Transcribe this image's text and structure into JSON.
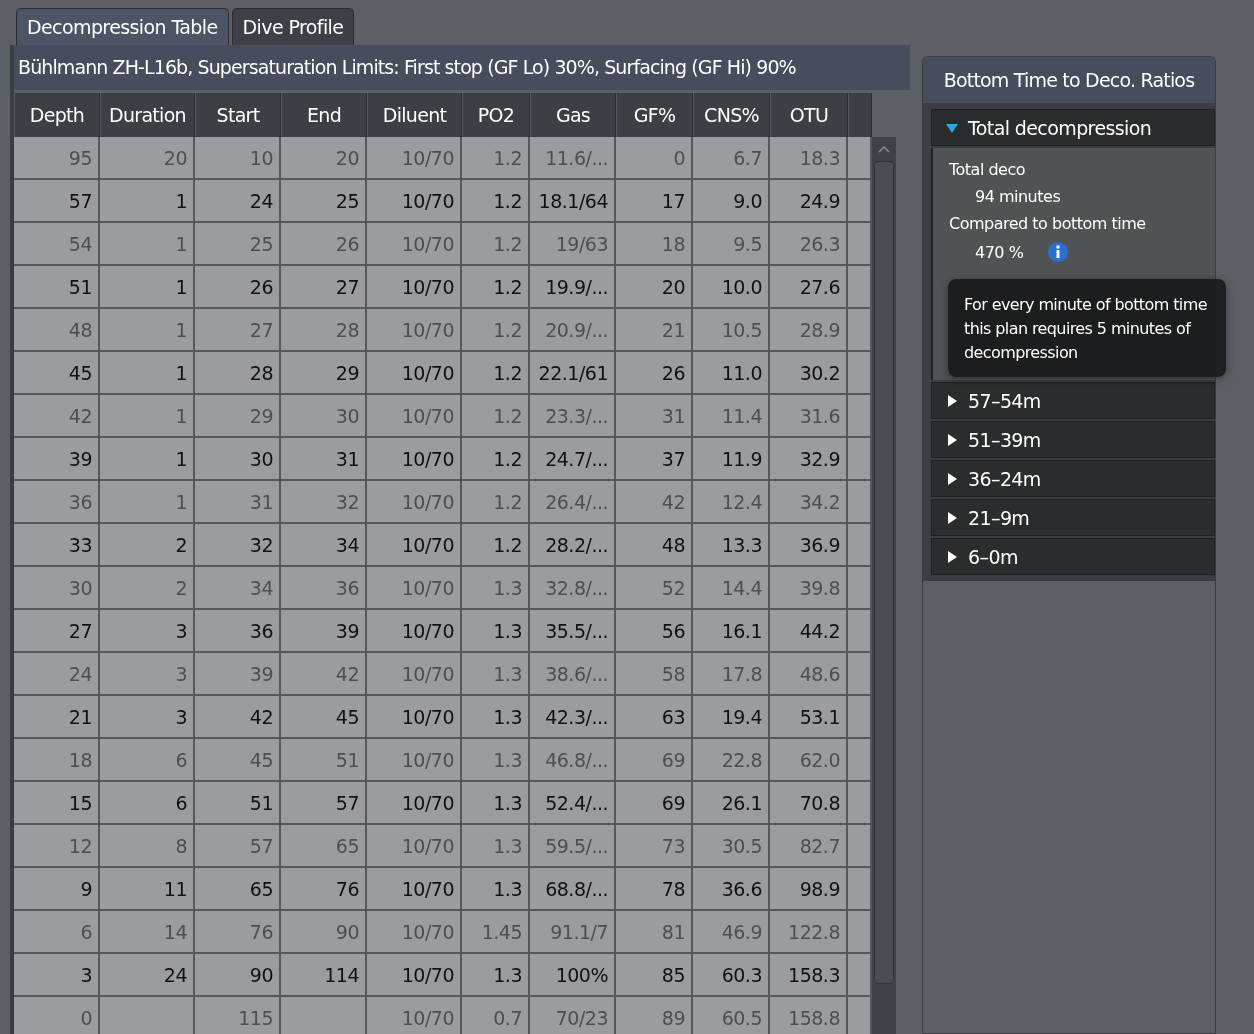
{
  "tabs": [
    {
      "label": "Decompression Table",
      "selected": true
    },
    {
      "label": "Dive Profile",
      "selected": false
    }
  ],
  "table": {
    "caption": "Bühlmann ZH-L16b, Supersaturation Limits: First stop (GF Lo) 30%, Surfacing (GF Hi) 90%",
    "columns": [
      "Depth",
      "Duration",
      "Start",
      "End",
      "Diluent",
      "PO2",
      "Gas",
      "GF%",
      "CNS%",
      "OTU"
    ],
    "rows": [
      {
        "dimmed": true,
        "cells": [
          "95",
          "20",
          "10",
          "20",
          "10/70",
          "1.2",
          "11.6/...",
          "0",
          "6.7",
          "18.3"
        ]
      },
      {
        "dimmed": false,
        "cells": [
          "57",
          "1",
          "24",
          "25",
          "10/70",
          "1.2",
          "18.1/64",
          "17",
          "9.0",
          "24.9"
        ]
      },
      {
        "dimmed": true,
        "cells": [
          "54",
          "1",
          "25",
          "26",
          "10/70",
          "1.2",
          "19/63",
          "18",
          "9.5",
          "26.3"
        ]
      },
      {
        "dimmed": false,
        "cells": [
          "51",
          "1",
          "26",
          "27",
          "10/70",
          "1.2",
          "19.9/...",
          "20",
          "10.0",
          "27.6"
        ]
      },
      {
        "dimmed": true,
        "cells": [
          "48",
          "1",
          "27",
          "28",
          "10/70",
          "1.2",
          "20.9/...",
          "21",
          "10.5",
          "28.9"
        ]
      },
      {
        "dimmed": false,
        "cells": [
          "45",
          "1",
          "28",
          "29",
          "10/70",
          "1.2",
          "22.1/61",
          "26",
          "11.0",
          "30.2"
        ]
      },
      {
        "dimmed": true,
        "cells": [
          "42",
          "1",
          "29",
          "30",
          "10/70",
          "1.2",
          "23.3/...",
          "31",
          "11.4",
          "31.6"
        ]
      },
      {
        "dimmed": false,
        "cells": [
          "39",
          "1",
          "30",
          "31",
          "10/70",
          "1.2",
          "24.7/...",
          "37",
          "11.9",
          "32.9"
        ]
      },
      {
        "dimmed": true,
        "cells": [
          "36",
          "1",
          "31",
          "32",
          "10/70",
          "1.2",
          "26.4/...",
          "42",
          "12.4",
          "34.2"
        ]
      },
      {
        "dimmed": false,
        "cells": [
          "33",
          "2",
          "32",
          "34",
          "10/70",
          "1.2",
          "28.2/...",
          "48",
          "13.3",
          "36.9"
        ]
      },
      {
        "dimmed": true,
        "cells": [
          "30",
          "2",
          "34",
          "36",
          "10/70",
          "1.3",
          "32.8/...",
          "52",
          "14.4",
          "39.8"
        ]
      },
      {
        "dimmed": false,
        "cells": [
          "27",
          "3",
          "36",
          "39",
          "10/70",
          "1.3",
          "35.5/...",
          "56",
          "16.1",
          "44.2"
        ]
      },
      {
        "dimmed": true,
        "cells": [
          "24",
          "3",
          "39",
          "42",
          "10/70",
          "1.3",
          "38.6/...",
          "58",
          "17.8",
          "48.6"
        ]
      },
      {
        "dimmed": false,
        "cells": [
          "21",
          "3",
          "42",
          "45",
          "10/70",
          "1.3",
          "42.3/...",
          "63",
          "19.4",
          "53.1"
        ]
      },
      {
        "dimmed": true,
        "cells": [
          "18",
          "6",
          "45",
          "51",
          "10/70",
          "1.3",
          "46.8/...",
          "69",
          "22.8",
          "62.0"
        ]
      },
      {
        "dimmed": false,
        "cells": [
          "15",
          "6",
          "51",
          "57",
          "10/70",
          "1.3",
          "52.4/...",
          "69",
          "26.1",
          "70.8"
        ]
      },
      {
        "dimmed": true,
        "cells": [
          "12",
          "8",
          "57",
          "65",
          "10/70",
          "1.3",
          "59.5/...",
          "73",
          "30.5",
          "82.7"
        ]
      },
      {
        "dimmed": false,
        "cells": [
          "9",
          "11",
          "65",
          "76",
          "10/70",
          "1.3",
          "68.8/...",
          "78",
          "36.6",
          "98.9"
        ]
      },
      {
        "dimmed": true,
        "cells": [
          "6",
          "14",
          "76",
          "90",
          "10/70",
          "1.45",
          "91.1/7",
          "81",
          "46.9",
          "122.8"
        ]
      },
      {
        "dimmed": false,
        "cells": [
          "3",
          "24",
          "90",
          "114",
          "10/70",
          "1.3",
          "100%",
          "85",
          "60.3",
          "158.3"
        ]
      },
      {
        "dimmed": true,
        "cells": [
          "0",
          null,
          "115",
          null,
          "10/70",
          "0.7",
          "70/23",
          "89",
          "60.5",
          "158.8"
        ]
      }
    ]
  },
  "ratios": {
    "title": "Bottom Time to Deco. Ratios",
    "sections": [
      {
        "label": "Total decompression",
        "expanded": true,
        "details": [
          {
            "label": "Total deco",
            "value": "94 minutes"
          },
          {
            "label": "Compared to bottom time",
            "value": "470 %",
            "info": true
          }
        ]
      },
      {
        "label": "57–54m",
        "expanded": false
      },
      {
        "label": "51–39m",
        "expanded": false
      },
      {
        "label": "36–24m",
        "expanded": false
      },
      {
        "label": "21–9m",
        "expanded": false
      },
      {
        "label": "6–0m",
        "expanded": false
      }
    ],
    "tooltip": "For every minute of bottom time this plan requires 5 minutes of decompression"
  }
}
